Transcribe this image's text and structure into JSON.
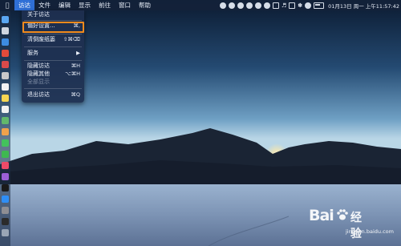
{
  "menubar": {
    "app_menu": "访达",
    "items": [
      "文件",
      "编辑",
      "显示",
      "前往",
      "窗口",
      "帮助"
    ],
    "clock": "01月13日 周一 上午11:57:42",
    "tray_glyphs": [
      "♬",
      "✽"
    ]
  },
  "dropdown": {
    "items": [
      {
        "label": "关于访达",
        "shortcut": "",
        "disabled": false
      },
      {
        "label": "偏好设置...",
        "shortcut": "⌘,",
        "disabled": false
      },
      {
        "label": "清倒废纸篓",
        "shortcut": "⇧⌘⌫",
        "disabled": false
      },
      {
        "label": "服务",
        "shortcut": "▶",
        "disabled": false
      },
      {
        "label": "隐藏访达",
        "shortcut": "⌘H",
        "disabled": false
      },
      {
        "label": "隐藏其他",
        "shortcut": "⌥⌘H",
        "disabled": false
      },
      {
        "label": "全部显示",
        "shortcut": "",
        "disabled": true
      },
      {
        "label": "退出访达",
        "shortcut": "⌘Q",
        "disabled": false
      }
    ]
  },
  "watermark": {
    "logo": "Bai",
    "logo_suffix": "经验",
    "url": "jingyan.baidu.com"
  },
  "colors": {
    "highlight": "#f08a1c",
    "menu_active": "#2f6fd6"
  },
  "dock_icons": [
    "finder-icon",
    "launchpad-icon",
    "safari-icon",
    "chrome-icon",
    "mail-icon",
    "contacts-icon",
    "calendar-icon",
    "notes-icon",
    "reminders-icon",
    "maps-icon",
    "photos-icon",
    "messages-icon",
    "facetime-icon",
    "music-icon",
    "podcasts-icon",
    "tv-icon",
    "appstore-icon",
    "preferences-icon",
    "terminal-icon",
    "trash-icon"
  ]
}
